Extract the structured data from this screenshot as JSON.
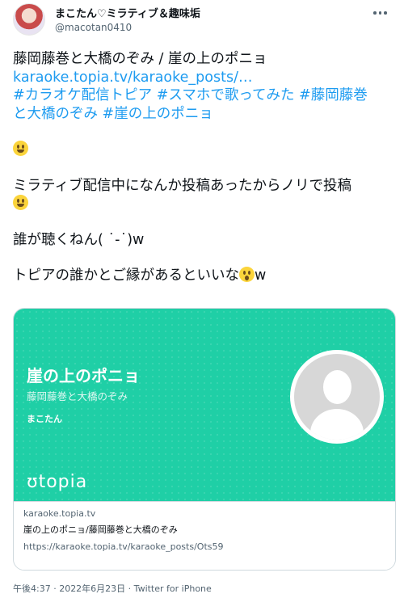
{
  "user": {
    "display_name": "まこたん♡ミラティブ＆趣味垢",
    "handle": "@macotan0410"
  },
  "tweet": {
    "title_line": "藤岡藤巻と大橋のぞみ / 崖の上のポニョ",
    "link": "karaoke.topia.tv/karaoke_posts/…",
    "hashtags_line1": "#カラオケ配信トピア #スマホで歌ってみた #藤岡藤巻",
    "hashtags_line2": "と大橋のぞみ #崖の上のポニョ",
    "body_line1": "ミラティブ配信中になんか投稿あったからノリで投稿",
    "body_line2": "誰が聴くねん( ˙-˙)w",
    "body_line3": "トピアの誰かとご縁があるといいな",
    "body_line3_suffix": "w"
  },
  "card": {
    "song": "崖の上のポニョ",
    "artist": "藤岡藤巻と大橋のぞみ",
    "poster": "まこたん",
    "logo": "ʊtopia",
    "domain": "karaoke.topia.tv",
    "title": "崖の上のポニョ/藤岡藤巻と大橋のぞみ",
    "url": "https://karaoke.topia.tv/karaoke_posts/Ots59"
  },
  "meta": "午後4:37 · 2022年6月23日 · Twitter for iPhone",
  "icons": [
    "avatar",
    "more-icon",
    "grinning-emoji-icon",
    "surprised-emoji-icon",
    "default-avatar-icon"
  ],
  "colors": {
    "link": "#1d9bf0",
    "card_bg": "#1fcfa6",
    "text": "#0f1419",
    "muted": "#536471"
  }
}
